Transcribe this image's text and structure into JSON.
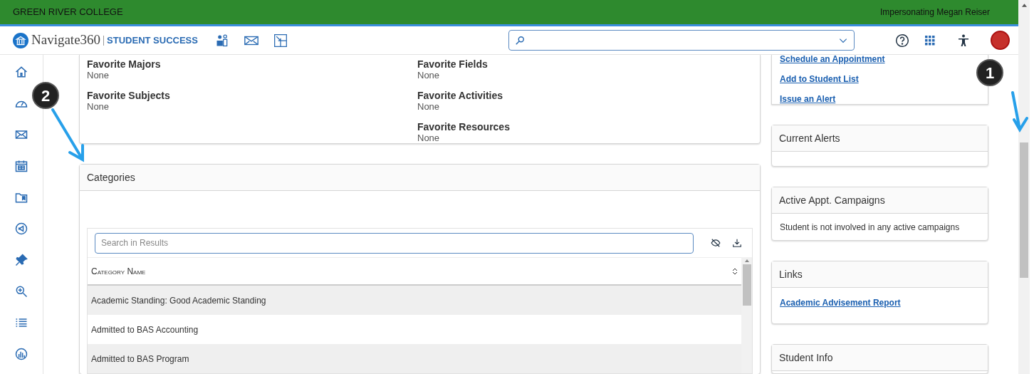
{
  "top_bar": {
    "college": "GREEN RIVER COLLEGE",
    "impersonating": "Impersonating Megan Reiser"
  },
  "header": {
    "brand": "Navigate360",
    "product": "STUDENT SUCCESS"
  },
  "sidebar": {
    "items": [
      {
        "kind": "home",
        "selected": false
      },
      {
        "kind": "dashboard",
        "selected": false
      },
      {
        "kind": "mail",
        "selected": false
      },
      {
        "kind": "calendar",
        "selected": false
      },
      {
        "kind": "folder",
        "selected": false
      },
      {
        "kind": "megaphone",
        "selected": false
      },
      {
        "kind": "pin",
        "selected": false
      },
      {
        "kind": "zoom",
        "selected": false
      },
      {
        "kind": "list",
        "selected": false
      },
      {
        "kind": "chart",
        "selected": false
      }
    ]
  },
  "favorites": [
    {
      "label": "Favorite Majors",
      "value": "None"
    },
    {
      "label": "Favorite Subjects",
      "value": "None"
    }
  ],
  "favorites_right": [
    {
      "label": "Favorite Fields",
      "value": "None"
    },
    {
      "label": "Favorite Activities",
      "value": "None"
    },
    {
      "label": "Favorite Resources",
      "value": "None"
    }
  ],
  "categories": {
    "title": "Categories",
    "search": {
      "placeholder": "Search in Results"
    },
    "column": "Category Name",
    "rows": [
      {
        "name": "Academic Standing: Good Academic Standing",
        "shaded": true
      },
      {
        "name": "Admitted to BAS Accounting",
        "shaded": false
      },
      {
        "name": "Admitted to BAS Program",
        "shaded": true
      }
    ]
  },
  "actions": [
    "Schedule an Appointment",
    "Add to Student List",
    "Issue an Alert"
  ],
  "current_alerts": {
    "title": "Current Alerts"
  },
  "campaigns": {
    "title": "Active Appt. Campaigns",
    "text": "Student is not involved in any active campaigns"
  },
  "links": {
    "title": "Links",
    "items": [
      "Academic Advisement Report"
    ]
  },
  "student_info": {
    "title": "Student Info"
  },
  "callouts": [
    {
      "label": "1"
    },
    {
      "label": "2"
    }
  ]
}
